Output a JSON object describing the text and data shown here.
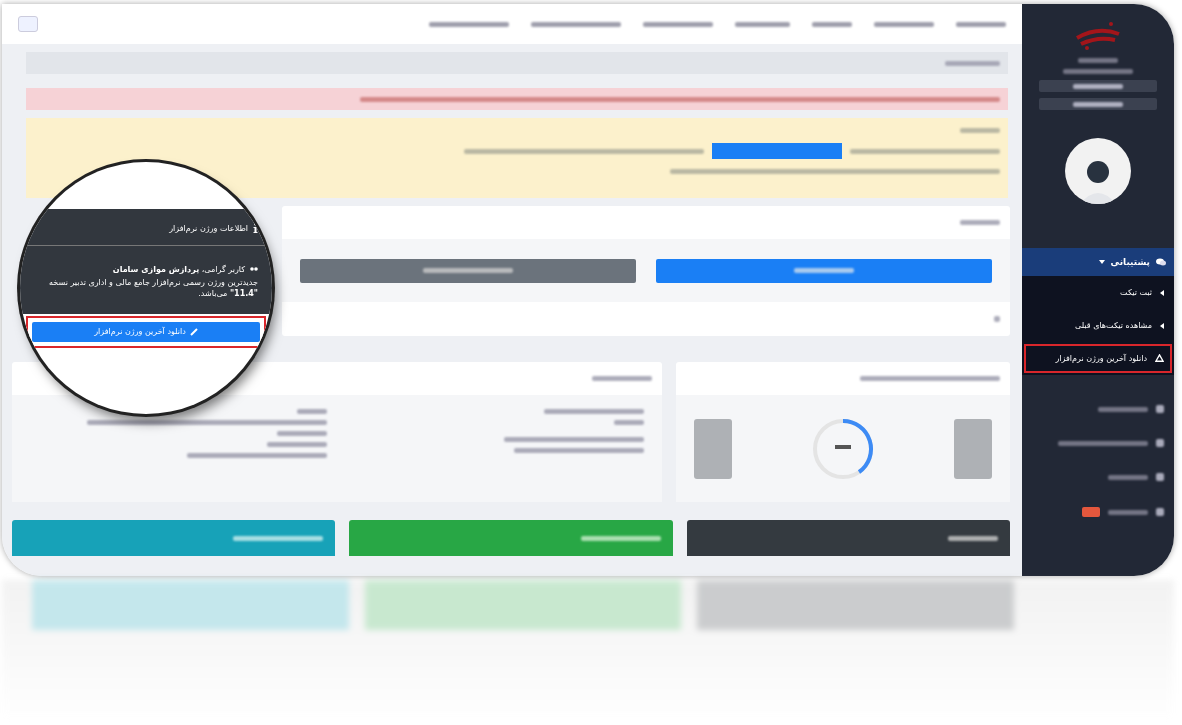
{
  "sidebar": {
    "menu": [
      {
        "label": "پشتیبانی",
        "expanded": true,
        "children": [
          {
            "label": "ثبت تیکت",
            "highlighted": false
          },
          {
            "label": "مشاهده تیکت‌های قبلی",
            "highlighted": false
          },
          {
            "label": "دانلود آخرین ورژن نرم‌افزار",
            "highlighted": true
          }
        ]
      }
    ]
  },
  "magnifier": {
    "title": "اطلاعات ورژن نرم‌افزار",
    "greeting": "کاربر گرامی، **پردازش موازی سامان**",
    "message": "جدیدترین ورژن رسمی نرم‌افزار جامع مالی و اداری تدبیر نسخه **\"11.4\"** می‌باشد.",
    "button": {
      "label": "دانلود آخرین ورژن نرم‌افزار",
      "highlighted": true
    }
  }
}
